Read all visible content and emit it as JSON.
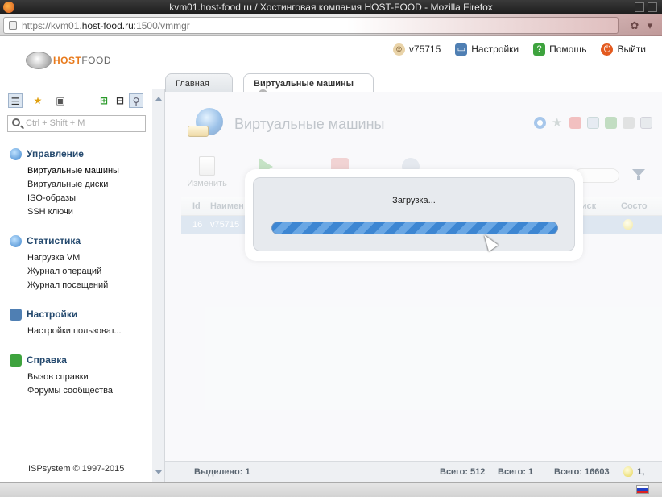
{
  "window": {
    "title": "kvm01.host-food.ru / Хостинговая компания HOST-FOOD - Mozilla Firefox"
  },
  "address_bar": {
    "url_prefix": "https://kvm01.",
    "url_host": "host-food.ru",
    "url_rest": ":1500/vmmgr"
  },
  "brand": {
    "logo_accent": "HOST",
    "logo_rest": "FOOD",
    "accent_color": "#e87a1c"
  },
  "top_menu": {
    "user": "v75715",
    "settings": "Настройки",
    "help": "Помощь",
    "logout": "Выйти"
  },
  "sidebar": {
    "search_placeholder": "Ctrl + Shift + M",
    "groups": [
      {
        "title": "Управление",
        "icon": "globe-icon",
        "links": [
          "Виртуальные машины",
          "Виртуальные диски",
          "ISO-образы",
          "SSH ключи"
        ]
      },
      {
        "title": "Статистика",
        "icon": "chart-icon",
        "links": [
          "Нагрузка VM",
          "Журнал операций",
          "Журнал посещений"
        ]
      },
      {
        "title": "Настройки",
        "icon": "monitor-icon",
        "links": [
          "Настройки пользоват..."
        ]
      },
      {
        "title": "Справка",
        "icon": "help-icon",
        "links": [
          "Вызов справки",
          "Форумы сообщества"
        ]
      }
    ],
    "copyright": "ISPsystem © 1997-2015"
  },
  "tabs": [
    {
      "label": "Главная"
    },
    {
      "label": "Виртуальные машины"
    }
  ],
  "main": {
    "title": "Виртуальные машины",
    "toolbar_edit": "Изменить"
  },
  "grid": {
    "headers": [
      "Id",
      "Наимен",
      "р диск",
      "Состо"
    ],
    "row": {
      "id": "16",
      "name": "v75715"
    }
  },
  "dialog": {
    "message": "Загрузка..."
  },
  "status": {
    "selected": "Выделено: 1",
    "total1": "Всего: 512",
    "total2": "Всего: 1",
    "total3": "Всего: 16603",
    "count": "1,"
  }
}
